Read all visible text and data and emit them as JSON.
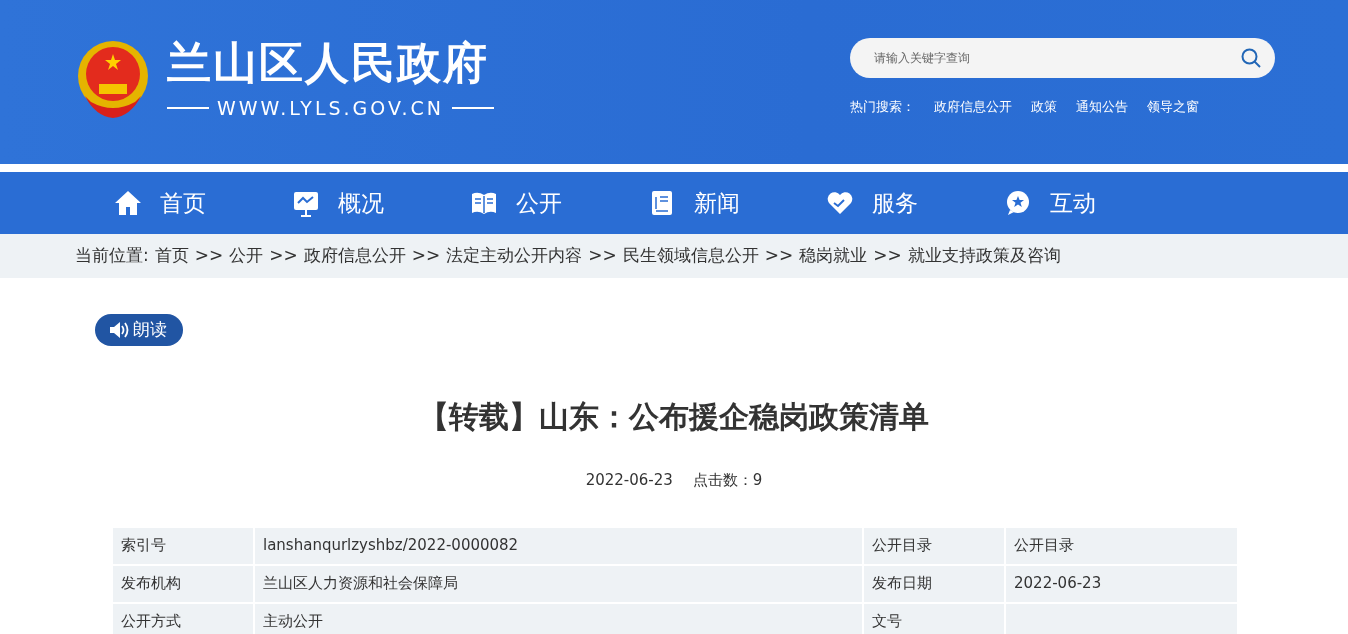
{
  "header": {
    "site_title": "兰山区人民政府",
    "site_url": "WWW.LYLS.GOV.CN",
    "search": {
      "placeholder": "请输入关键字查询"
    },
    "hot_label": "热门搜索：",
    "hot_links": [
      "政府信息公开",
      "政策",
      "通知公告",
      "领导之窗"
    ]
  },
  "nav": [
    {
      "label": "首页",
      "kind": "home"
    },
    {
      "label": "概况",
      "kind": "board"
    },
    {
      "label": "公开",
      "kind": "book"
    },
    {
      "label": "新闻",
      "kind": "paper"
    },
    {
      "label": "服务",
      "kind": "heart"
    },
    {
      "label": "互动",
      "kind": "chat"
    }
  ],
  "breadcrumb": {
    "prefix": "当前位置:",
    "items": [
      "首页",
      ">>",
      "公开",
      ">>",
      "政府信息公开",
      ">>",
      "法定主动公开内容",
      ">>",
      "民生领域信息公开",
      ">>",
      "稳岗就业",
      ">>",
      "就业支持政策及咨询"
    ]
  },
  "read_aloud_button": "朗读",
  "article": {
    "title": "【转载】山东：公布援企稳岗政策清单",
    "date": "2022-06-23",
    "views": "点击数：9",
    "meta": [
      [
        {
          "label": "索引号",
          "value": "lanshanqurlzyshbz/2022-0000082"
        },
        {
          "label": "公开目录",
          "value": "公开目录"
        }
      ],
      [
        {
          "label": "发布机构",
          "value": "兰山区人力资源和社会保障局"
        },
        {
          "label": "发布日期",
          "value": "2022-06-23"
        }
      ],
      [
        {
          "label": "公开方式",
          "value": "主动公开"
        },
        {
          "label": "文号"
        }
      ]
    ]
  }
}
